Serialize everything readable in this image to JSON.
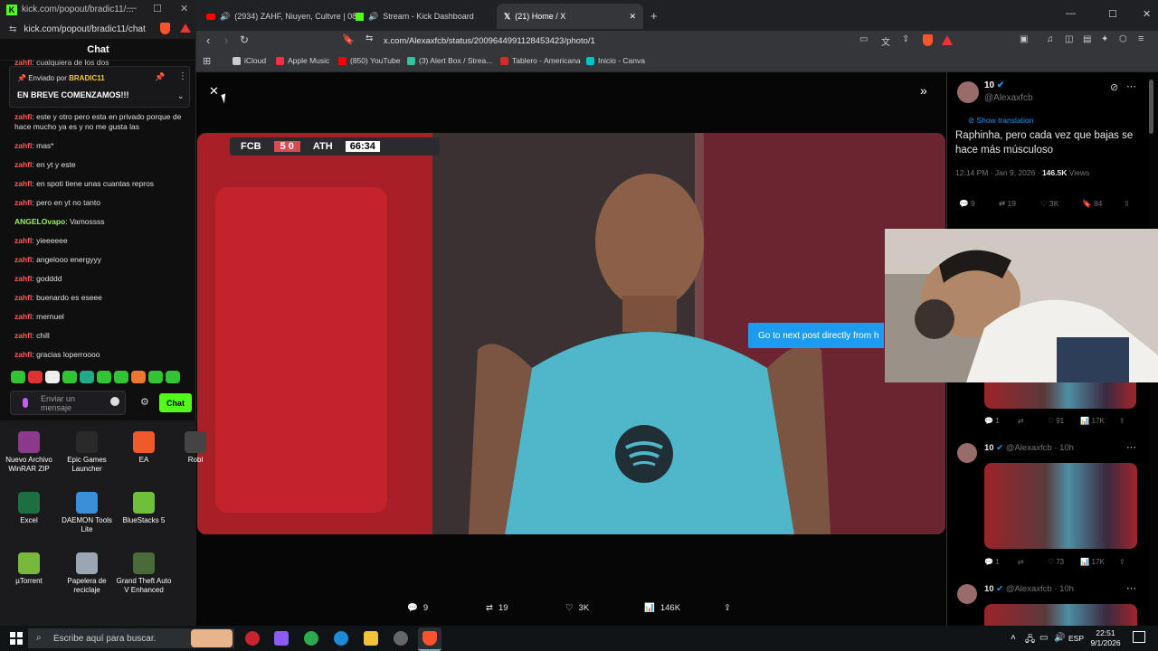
{
  "kick": {
    "tab_title": "kick.com/popout/bradic11/...",
    "url": "kick.com/popout/bradic11/chat",
    "header": "Chat",
    "pinned": {
      "by_label": "Enviado por",
      "by_user": "BRADIC11",
      "message": "EN BREVE COMENZAMOS!!!"
    },
    "top_fragment": "cualquiera de los dos",
    "messages": [
      {
        "user": "zahfl",
        "text": "este y otro pero esta en privado porque de hace mucho ya es y no me gusta las"
      },
      {
        "user": "zahfl",
        "text": "mas*"
      },
      {
        "user": "zahfl",
        "text": "en yt y este"
      },
      {
        "user": "zahfl",
        "text": "en spoti tiene unas cuantas repros"
      },
      {
        "user": "zahfl",
        "text": "pero en yt no tanto"
      },
      {
        "user": "ANGELOvapo",
        "text": "Vamossss",
        "green": true
      },
      {
        "user": "zahfl",
        "text": "yieeeeee"
      },
      {
        "user": "zahfl",
        "text": "angelooo energyyy"
      },
      {
        "user": "zahfl",
        "text": "godddd"
      },
      {
        "user": "zahfl",
        "text": "buenardo es eseee"
      },
      {
        "user": "zahfl",
        "text": "mernuel"
      },
      {
        "user": "zahfl",
        "text": "chill"
      },
      {
        "user": "zahfl",
        "text": "gracias loperroooo"
      }
    ],
    "input_placeholder": "Enviar un mensaje",
    "send_label": "Chat"
  },
  "desktop_icons": [
    {
      "label": "Nuevo Archivo WinRAR ZIP",
      "color": "#8b3a8b"
    },
    {
      "label": "Epic Games Launcher",
      "color": "#2a2a2a"
    },
    {
      "label": "EA",
      "color": "#f05a28"
    },
    {
      "label": "Robl",
      "color": "#444444"
    },
    {
      "label": "Excel",
      "color": "#1d6f42"
    },
    {
      "label": "DAEMON Tools Lite",
      "color": "#3a8fd8"
    },
    {
      "label": "BlueStacks 5",
      "color": "#6fbf3a"
    },
    {
      "label": "µTorrent",
      "color": "#78b83a"
    },
    {
      "label": "Papelera de reciclaje",
      "color": "#9aa7b2"
    },
    {
      "label": "Grand Theft Auto V Enhanced",
      "color": "#4a6a3a"
    }
  ],
  "browser": {
    "tabs": [
      {
        "title": "(2934) ZAHF, Niuyen, Cultvre | 08"
      },
      {
        "title": "Stream - Kick Dashboard"
      },
      {
        "title": "(21) Home / X"
      }
    ],
    "address": "x.com/Alexaxfcb/status/2009644991128453423/photo/1",
    "bookmarks": [
      {
        "label": "iCloud",
        "color": "#cccccc"
      },
      {
        "label": "Apple Music",
        "color": "#fa2d48"
      },
      {
        "label": "(850) YouTube",
        "color": "#ff0000"
      },
      {
        "label": "(3) Alert Box / Strea...",
        "color": "#31c3a2"
      },
      {
        "label": "Tablero - Americana",
        "color": "#d42a2a"
      },
      {
        "label": "Inicio - Canva",
        "color": "#00c4cc"
      }
    ]
  },
  "media": {
    "score_home": "FCB",
    "score_result": "5 0",
    "score_away": "ATH",
    "score_time": "66:34",
    "next_post": "Go to next post directly from h",
    "actions": {
      "replies": "9",
      "reposts": "19",
      "likes": "3K",
      "views": "146K"
    }
  },
  "post": {
    "author": "10",
    "handle": "@Alexaxfcb",
    "translate": "Show translation",
    "text": "Raphinha, pero cada vez que bajas se hace más músculoso",
    "time": "12:14 PM · Jan 9, 2026 ·",
    "views_count": "146.5K",
    "views_label": "Views",
    "stats": {
      "replies": "9",
      "reposts": "19",
      "likes": "3K",
      "bookmarks": "84"
    }
  },
  "replies": [
    {
      "stats": {
        "replies": "1",
        "likes": "91",
        "views": "17K"
      }
    },
    {
      "author": "10",
      "handle": "@Alexaxfcb · 10h",
      "stats": {
        "replies": "1",
        "likes": "73",
        "views": "17K"
      }
    },
    {
      "author": "10",
      "handle": "@Alexaxfcb · 10h"
    }
  ],
  "taskbar": {
    "search_placeholder": "Escribe aquí para buscar.",
    "lang": "ESP",
    "time": "22:51",
    "date": "9/1/2026"
  }
}
